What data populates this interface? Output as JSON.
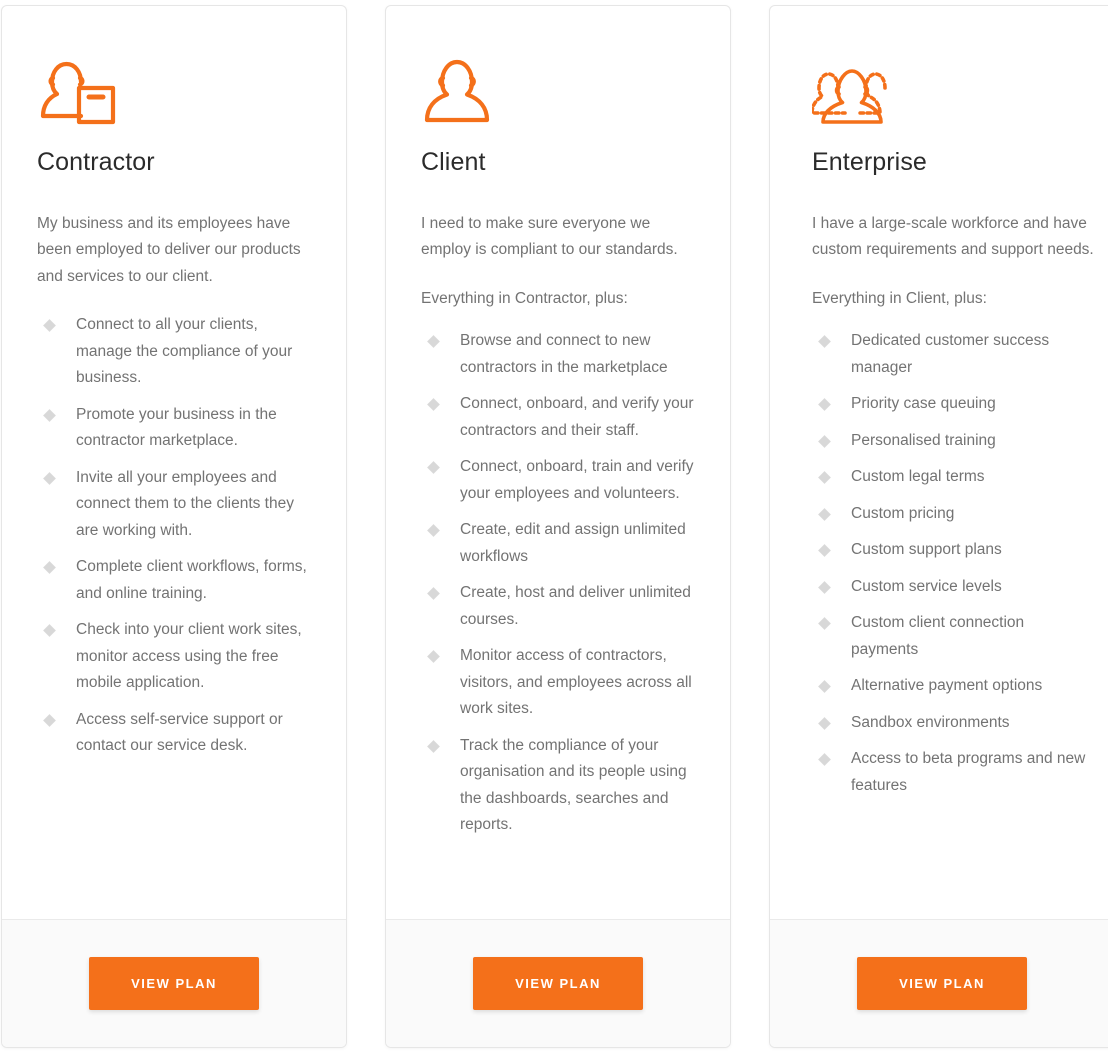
{
  "theme": {
    "accent": "#f4701a",
    "title_color": "#2b2b2b",
    "body_color": "#737373",
    "bullet_color": "#d8d8d8",
    "card_bg": "#ffffff",
    "footer_bg": "#fafafa",
    "card_border": "#e6e6e6"
  },
  "plans": [
    {
      "id": "contractor",
      "icon": "person-with-toolbox-icon",
      "title": "Contractor",
      "description": "My business and its employees have been employed to deliver our products and services to our client.",
      "intro": "",
      "features": [
        "Connect to all your clients, manage the compliance of your business.",
        "Promote your business in the contractor marketplace.",
        "Invite all your employees and connect them to the clients they are working with.",
        "Complete client workflows, forms, and online training.",
        "Check into your client work sites, monitor access using the free mobile application.",
        "Access self-service support or contact our service desk."
      ],
      "cta_label": "View Plan"
    },
    {
      "id": "client",
      "icon": "single-person-icon",
      "title": "Client",
      "description": "I need to make sure everyone we employ is compliant to our standards.",
      "intro": "Everything in Contractor, plus:",
      "features": [
        "Browse and connect to new contractors in the marketplace",
        "Connect, onboard, and verify your contractors and their staff.",
        "Connect, onboard, train and verify your employees and volunteers.",
        "Create, edit and assign unlimited workflows",
        "Create, host and deliver unlimited courses.",
        "Monitor access of contractors, visitors, and employees across all work sites.",
        "Track the compliance of your organisation and its people using the dashboards, searches and reports."
      ],
      "cta_label": "View Plan"
    },
    {
      "id": "enterprise",
      "icon": "group-of-people-icon",
      "title": "Enterprise",
      "description": "I have a large-scale workforce and have custom requirements and support needs.",
      "intro": "Everything in Client, plus:",
      "features": [
        "Dedicated customer success manager",
        "Priority case queuing",
        "Personalised training",
        "Custom legal terms",
        "Custom pricing",
        "Custom support plans",
        "Custom service levels",
        "Custom client connection payments",
        "Alternative payment options",
        "Sandbox environments",
        "Access to beta programs and new features"
      ],
      "cta_label": "View Plan"
    }
  ]
}
